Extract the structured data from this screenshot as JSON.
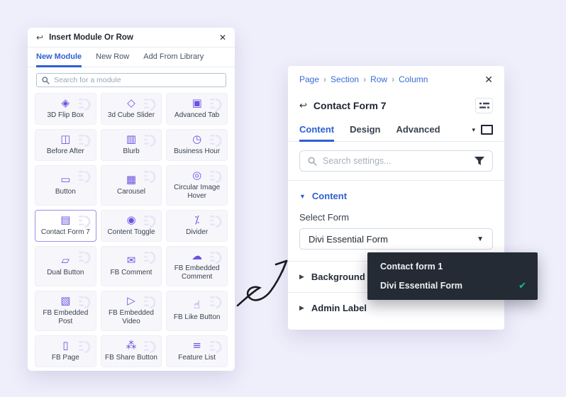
{
  "icons": {
    "back": "↩",
    "close": "✕",
    "caret_down": "▼",
    "caret_right": "▶",
    "caret_small": "▾",
    "check": "✔",
    "breadcrumb_sep": "›"
  },
  "module_panel": {
    "title": "Insert Module Or Row",
    "tabs": [
      {
        "label": "New Module"
      },
      {
        "label": "New Row"
      },
      {
        "label": "Add From Library"
      }
    ],
    "search_placeholder": "Search for a module",
    "modules": [
      {
        "label": "3D Flip Box",
        "glyph": "◈"
      },
      {
        "label": "3d Cube Slider",
        "glyph": "◇"
      },
      {
        "label": "Advanced Tab",
        "glyph": "▣"
      },
      {
        "label": "Before After",
        "glyph": "◫"
      },
      {
        "label": "Blurb",
        "glyph": "▥"
      },
      {
        "label": "Business Hour",
        "glyph": "◷"
      },
      {
        "label": "Button",
        "glyph": "▭"
      },
      {
        "label": "Carousel",
        "glyph": "▦"
      },
      {
        "label": "Circular Image Hover",
        "glyph": "◎"
      },
      {
        "label": "Contact Form 7",
        "glyph": "▤",
        "selected": true
      },
      {
        "label": "Content Toggle",
        "glyph": "◉"
      },
      {
        "label": "Divider",
        "glyph": "⁒"
      },
      {
        "label": "Dual Button",
        "glyph": "▱"
      },
      {
        "label": "FB Comment",
        "glyph": "✉"
      },
      {
        "label": "FB Embedded Comment",
        "glyph": "☁"
      },
      {
        "label": "FB Embedded Post",
        "glyph": "▧"
      },
      {
        "label": "FB Embedded Video",
        "glyph": "▷"
      },
      {
        "label": "FB Like Button",
        "glyph": "☝"
      },
      {
        "label": "FB Page",
        "glyph": "▯"
      },
      {
        "label": "FB Share Button",
        "glyph": "⁂"
      },
      {
        "label": "Feature List",
        "glyph": "≡"
      }
    ]
  },
  "settings_panel": {
    "breadcrumb": [
      {
        "label": "Page"
      },
      {
        "label": "Section"
      },
      {
        "label": "Row"
      },
      {
        "label": "Column"
      }
    ],
    "title": "Contact Form 7",
    "tabs": [
      {
        "label": "Content"
      },
      {
        "label": "Design"
      },
      {
        "label": "Advanced"
      }
    ],
    "search_placeholder": "Search settings...",
    "content_section": {
      "label": "Content"
    },
    "select_form": {
      "label": "Select Form",
      "value": "Divi Essential Form"
    },
    "background_section": {
      "label": "Background"
    },
    "admin_label_section": {
      "label": "Admin Label"
    }
  },
  "form_dropdown": {
    "items": [
      {
        "label": "Contact form 1"
      },
      {
        "label": "Divi Essential Form",
        "selected": true
      }
    ]
  },
  "colors": {
    "accent_blue": "#2d5fd3",
    "icon_purple": "#6d52e3",
    "selected_border": "#a08df0",
    "menu_dark": "#242b34",
    "check_green": "#10c184",
    "page_bg": "#efeefb"
  }
}
